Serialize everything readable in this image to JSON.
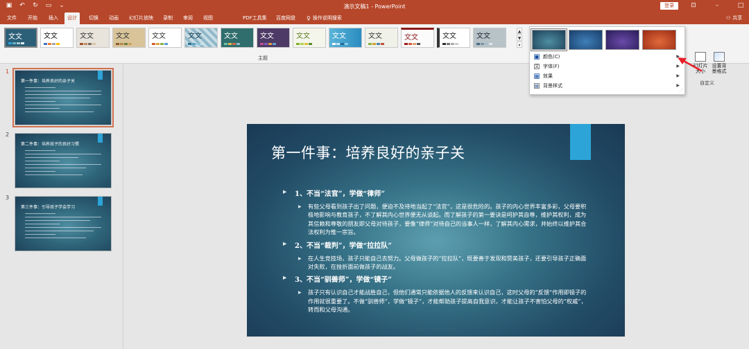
{
  "app": {
    "document_title": "演示文稿1 - PowerPoint",
    "login_label": "登录",
    "share_label": "共享"
  },
  "tabs": [
    {
      "label": "文件"
    },
    {
      "label": "开始"
    },
    {
      "label": "插入"
    },
    {
      "label": "设计"
    },
    {
      "label": "切换"
    },
    {
      "label": "动画"
    },
    {
      "label": "幻灯片放映"
    },
    {
      "label": "录制"
    },
    {
      "label": "审阅"
    },
    {
      "label": "视图"
    },
    {
      "label": "PDF工具集"
    },
    {
      "label": "百度网盘"
    }
  ],
  "tell_me": "操作说明搜索",
  "ribbon": {
    "themes_group_label": "主题",
    "customize_group_label": "自定义",
    "theme_sample_text": "文文",
    "slide_size_label": "幻灯片\n大小",
    "format_bg_label": "设置背\n景格式"
  },
  "variants_menu": {
    "items": [
      {
        "label": "颜色(C)",
        "icon": "color-palette-icon"
      },
      {
        "label": "字体(F)",
        "icon": "font-icon"
      },
      {
        "label": "效果",
        "icon": "effects-icon"
      },
      {
        "label": "背景样式",
        "icon": "background-style-icon"
      }
    ]
  },
  "thumbnails": [
    {
      "number": "1",
      "title": "第一件事：培养良好的亲子关"
    },
    {
      "number": "2",
      "title": "第二件事：培养孩子的良好习惯"
    },
    {
      "number": "3",
      "title": "第三件事：引导孩子学会学习"
    }
  ],
  "slide": {
    "title": "第一件事：培养良好的亲子关",
    "sections": [
      {
        "heading": "1、不当“法官”，学做“律师”",
        "text": "有些父母看到孩子出了问题，便迫不及待地当起了“法官”，这是很危险的。孩子的内心世界丰富多彩，父母要积极地影响与教育孩子，不了解其内心世界便无从谈起。而了解孩子的第一要诀是呵护其自尊，维护其权利，成为其信赖和尊敬的朋友即父母对待孩子，要像“律师”对待自己的当事人一样，了解其内心需求，并始终以维护其合法权利为惟一宗旨。"
      },
      {
        "heading": "2、不当“裁判”，学做“拉拉队”",
        "text": "在人生竞技场，孩子只能自己去努力。父母做孩子的“拉拉队”，既要善于发现和赞美孩子，还要引导孩子正确面对失败，在挫折面前做孩子的战友。"
      },
      {
        "heading": "3、不当“驯兽师”，学做“镜子”",
        "text": "孩子只有认识自己才能战胜自己，但他们通常只能依据他人的反馈来认识自己，这时父母的“反馈”作用即镜子的作用就很重要了。不做“驯兽师”，学做“镜子”，才能帮助孩子提高自我意识，才能让孩子不害怕父母的“权威”，转而和父母沟通。"
      }
    ]
  },
  "colors": {
    "accent": "#b7472a",
    "slide_accent": "#2ca4d8",
    "slide_bg_dark": "#1a3a55"
  }
}
